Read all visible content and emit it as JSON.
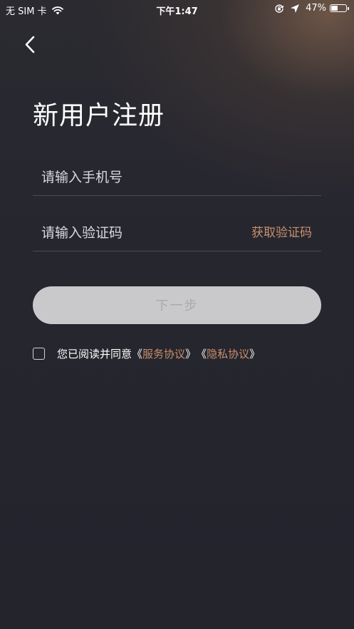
{
  "status_bar": {
    "carrier": "无 SIM 卡",
    "time": "下午1:47",
    "battery_percent": "47%",
    "battery_level": 0.47,
    "icons": [
      "wifi-icon",
      "rotation-lock-icon",
      "location-arrow-icon",
      "battery-icon"
    ]
  },
  "nav": {
    "back_icon": "chevron-left-icon"
  },
  "page": {
    "title": "新用户注册"
  },
  "form": {
    "phone_placeholder": "请输入手机号",
    "phone_value": "",
    "code_placeholder": "请输入验证码",
    "code_value": "",
    "get_code_label": "获取验证码",
    "next_label": "下一步"
  },
  "agreement": {
    "checked": false,
    "prefix": "您已阅读并同意",
    "service_open": "《",
    "service_label": "服务协议",
    "service_close": "》",
    "privacy_open": "《",
    "privacy_label": "隐私协议",
    "privacy_close": "》"
  },
  "colors": {
    "accent": "#c8906a",
    "background": "#262630",
    "button_disabled_bg": "#c9c9cc",
    "button_disabled_text": "#a9a9ae"
  }
}
